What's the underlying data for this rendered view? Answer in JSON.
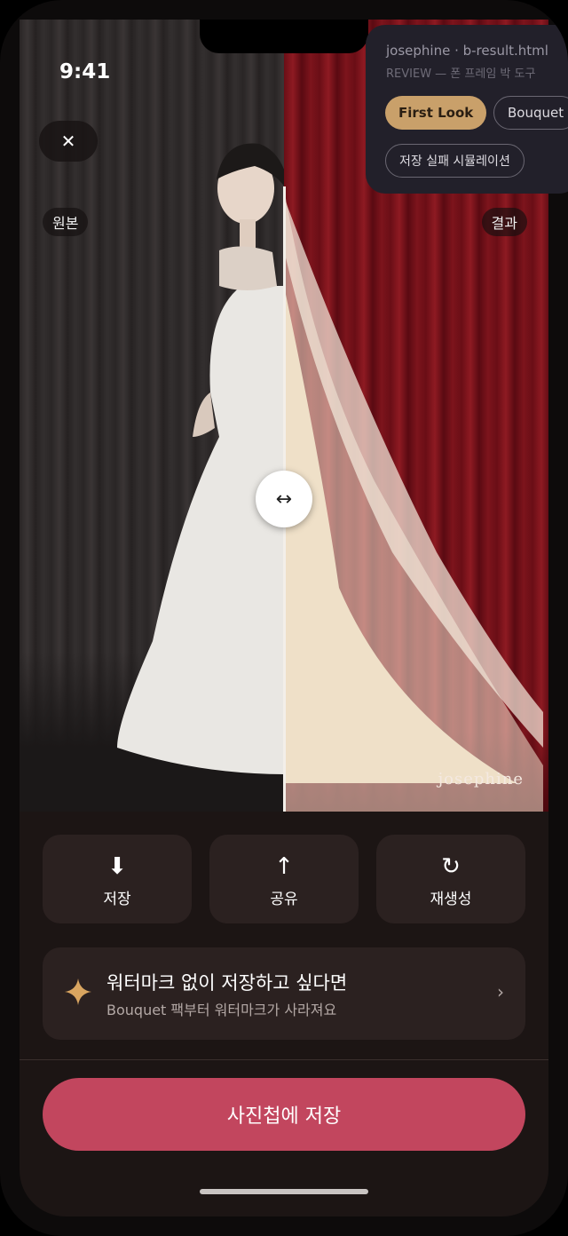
{
  "status_bar": {
    "time": "9:41"
  },
  "review_panel": {
    "file": "josephine · b-result.html",
    "subtitle": "REVIEW — 폰 프레임 박 도구",
    "chips": [
      "First Look",
      "Bouquet",
      "저장 실패 시뮬레이션"
    ],
    "active_chip": "First Look"
  },
  "compare": {
    "left_label": "원본",
    "right_label": "결과",
    "watermark": "josephine",
    "handle_icon": "↔",
    "divider_position": 0.5
  },
  "close_button": {
    "icon": "✕"
  },
  "actions": [
    {
      "icon": "download-icon",
      "glyph": "⬇",
      "label": "저장"
    },
    {
      "icon": "share-icon",
      "glyph": "↑",
      "label": "공유"
    },
    {
      "icon": "regenerate-icon",
      "glyph": "↻",
      "label": "재생성"
    }
  ],
  "upsell": {
    "title": "워터마크 없이 저장하고 싶다면",
    "subtitle": "Bouquet 팩부터 워터마크가 사라져요",
    "chevron": "›",
    "accent": "#d9a560"
  },
  "primary_button": {
    "label": "사진첩에 저장",
    "color": "#c2465e"
  }
}
